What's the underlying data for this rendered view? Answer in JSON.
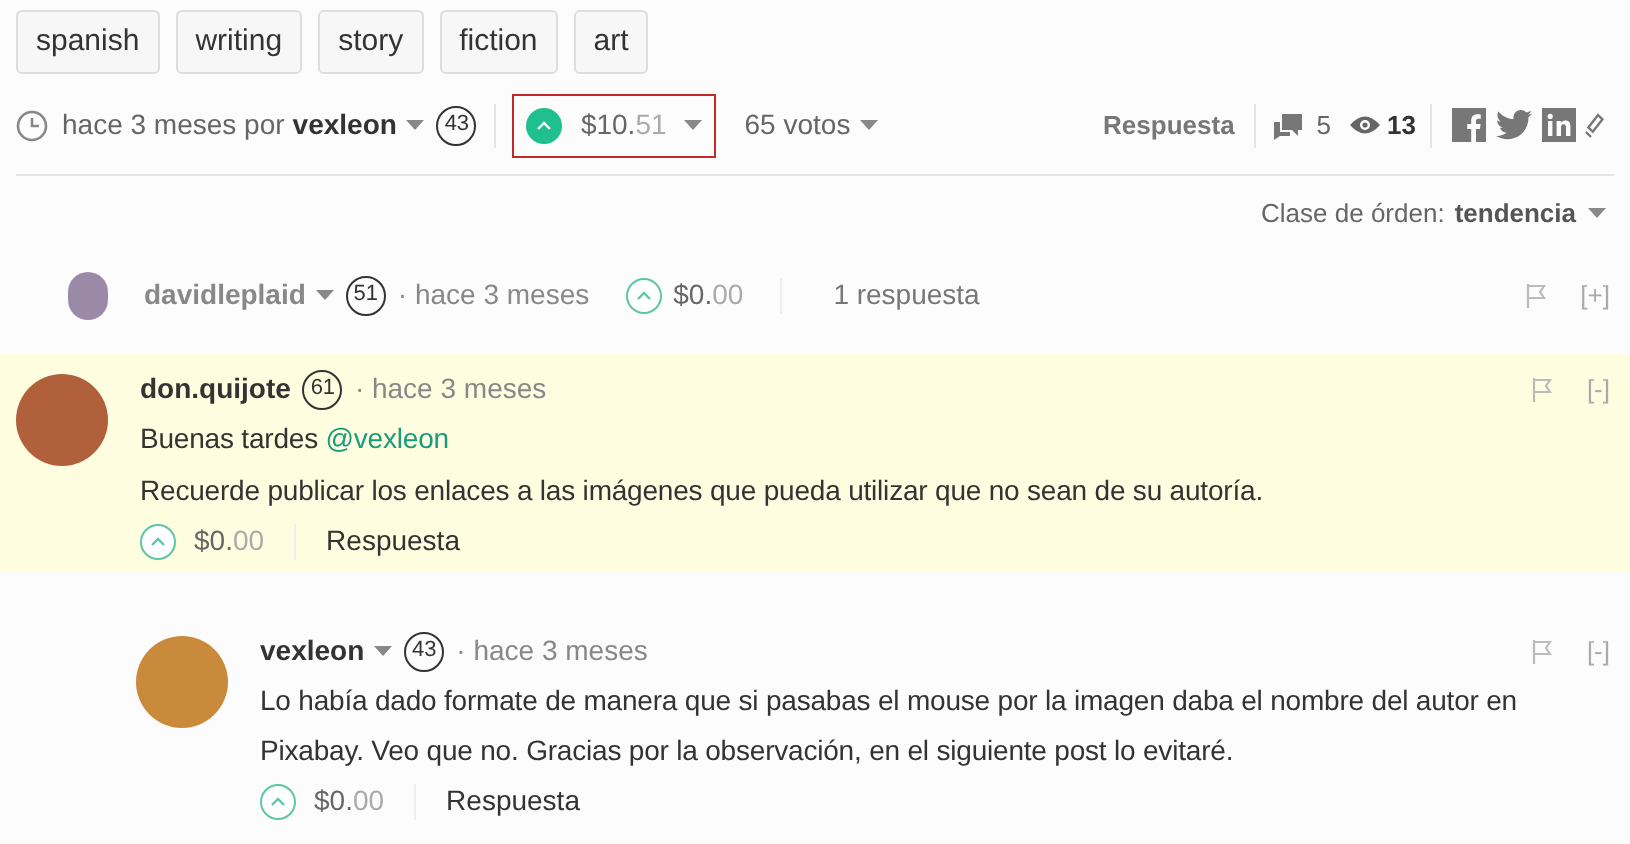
{
  "tags": [
    "spanish",
    "writing",
    "story",
    "fiction",
    "art"
  ],
  "post_meta": {
    "time": "hace 3 meses por",
    "author": "vexleon",
    "reputation": "43",
    "payout_main": "$10.",
    "payout_fraction": "51",
    "votes": "65 votos",
    "reply": "Respuesta",
    "comments_count": "5",
    "views_count": "13"
  },
  "sort": {
    "label": "Clase de órden:",
    "value": "tendencia"
  },
  "comments": [
    {
      "author": "davidleplaid",
      "has_menu": true,
      "reputation": "51",
      "time": "· hace 3 meses",
      "payout_main": "$0.",
      "payout_fraction": "00",
      "collapsed": true,
      "replies_label": "1 respuesta",
      "toggle": "[+]"
    },
    {
      "author": "don.quijote",
      "has_menu": false,
      "reputation": "61",
      "time": "· hace 3 meses",
      "payout_main": "$0.",
      "payout_fraction": "00",
      "collapsed": false,
      "highlighted": true,
      "toggle": "[-]",
      "reply": "Respuesta",
      "body": [
        {
          "text": "Buenas tardes",
          "mention": "@vexleon"
        },
        {
          "text": "Recuerde publicar los enlaces a las imágenes que pueda utilizar que no sean de su autoría."
        }
      ],
      "children": [
        {
          "author": "vexleon",
          "has_menu": true,
          "reputation": "43",
          "time": "· hace 3 meses",
          "payout_main": "$0.",
          "payout_fraction": "00",
          "collapsed": false,
          "toggle": "[-]",
          "reply": "Respuesta",
          "body": [
            {
              "text": "Lo había dado formate de manera que si pasabas el mouse por la imagen daba el nombre del autor en Pixabay. Veo que no. Gracias por la observación, en el siguiente post lo evitaré."
            }
          ]
        }
      ]
    }
  ]
}
